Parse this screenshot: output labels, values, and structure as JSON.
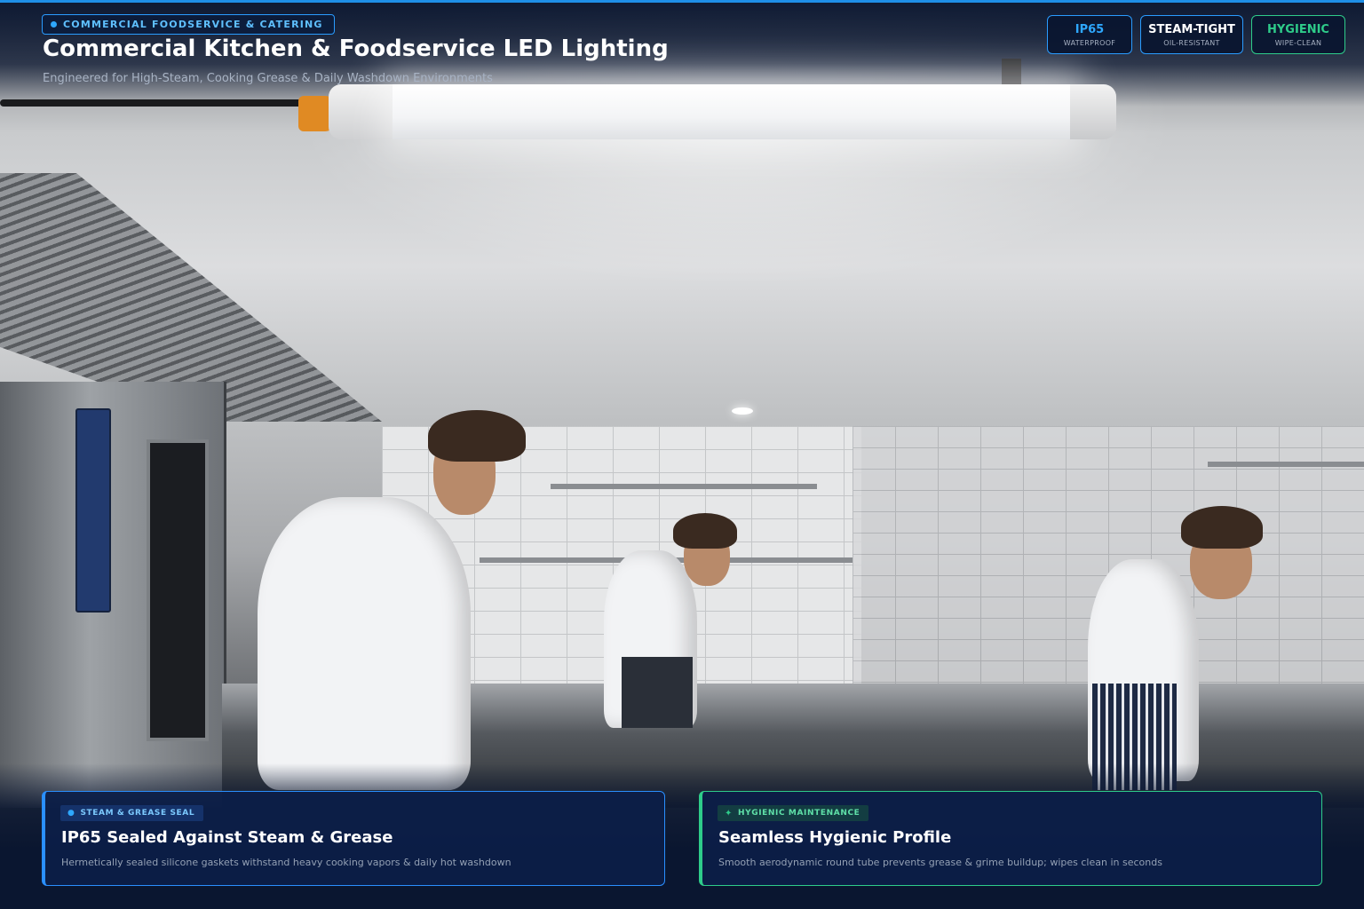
{
  "header": {
    "category": "COMMERCIAL FOODSERVICE & CATERING",
    "title": "Commercial Kitchen & Foodservice LED Lighting",
    "subtitle": "Engineered for High-Steam, Cooking Grease & Daily Washdown Environments"
  },
  "badges": [
    {
      "label": "IP65",
      "sub": "WATERPROOF",
      "color": "#2ea8ff"
    },
    {
      "label": "STEAM-TIGHT",
      "sub": "OIL-RESISTANT",
      "color": "#ffffff"
    },
    {
      "label": "HYGIENIC",
      "sub": "WIPE-CLEAN",
      "color": "#2ecc8a"
    }
  ],
  "cards": [
    {
      "tag": "STEAM & GREASE SEAL",
      "title": "IP65 Sealed Against Steam & Grease",
      "desc": "Hermetically sealed silicone gaskets withstand heavy cooking vapors & daily hot washdown",
      "accent": "#2a8fff"
    },
    {
      "tag": "HYGIENIC MAINTENANCE",
      "title": "Seamless Hygienic Profile",
      "desc": "Smooth aerodynamic round tube prevents grease & grime buildup; wipes clean in seconds",
      "accent": "#2ecc8a"
    }
  ],
  "icons": [
    "droplet-icon",
    "sparkle-icon"
  ]
}
